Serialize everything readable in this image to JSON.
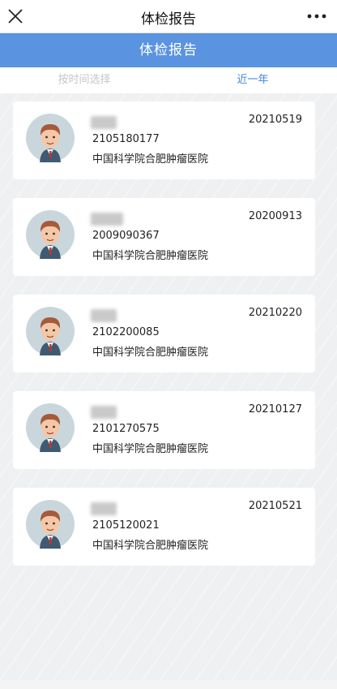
{
  "window": {
    "title": "体检报告",
    "close_icon": "close-icon",
    "more_icon": "more-dots-icon"
  },
  "banner": {
    "title": "体检报告"
  },
  "filters": {
    "time_select": "按时间选择",
    "recent_year": "近一年"
  },
  "reports": [
    {
      "name_hidden": true,
      "report_no": "2105180177",
      "hospital": "中国科学院合肥肿瘤医院",
      "date": "20210519"
    },
    {
      "name_hidden": true,
      "report_no": "2009090367",
      "hospital": "中国科学院合肥肿瘤医院",
      "date": "20200913"
    },
    {
      "name_hidden": true,
      "report_no": "2102200085",
      "hospital": "中国科学院合肥肿瘤医院",
      "date": "20210220"
    },
    {
      "name_hidden": true,
      "report_no": "2101270575",
      "hospital": "中国科学院合肥肿瘤医院",
      "date": "20210127"
    },
    {
      "name_hidden": true,
      "report_no": "2105120021",
      "hospital": "中国科学院合肥肿瘤医院",
      "date": "20210521"
    }
  ],
  "colors": {
    "banner": "#5a93e0",
    "active_tab": "#3d86e0",
    "inactive_tab": "#c6c6c6"
  }
}
